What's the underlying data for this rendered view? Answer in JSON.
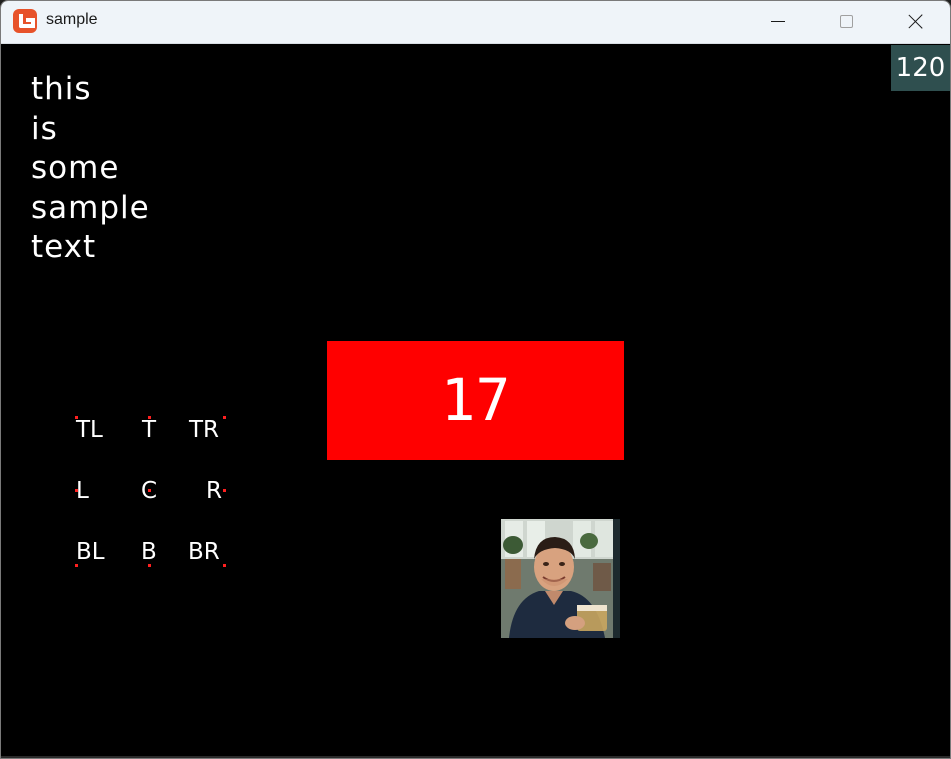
{
  "window": {
    "title": "sample",
    "controls": {
      "minimize": "minimize-button",
      "maximize": "maximize-button",
      "close": "close-button"
    }
  },
  "game": {
    "fps_counter": "120",
    "sample_text_lines": [
      "this",
      "is",
      "some",
      "sample",
      "text"
    ],
    "counter_value": "17",
    "counter_box_color": "#ff0000",
    "fps_box_color": "#2f4f4f",
    "anchor_dot_color": "#ff2020",
    "anchor_labels": {
      "tl": "TL",
      "t": "T",
      "tr": "TR",
      "l": "L",
      "c": "C",
      "r": "R",
      "bl": "BL",
      "b": "B",
      "br": "BR"
    }
  }
}
